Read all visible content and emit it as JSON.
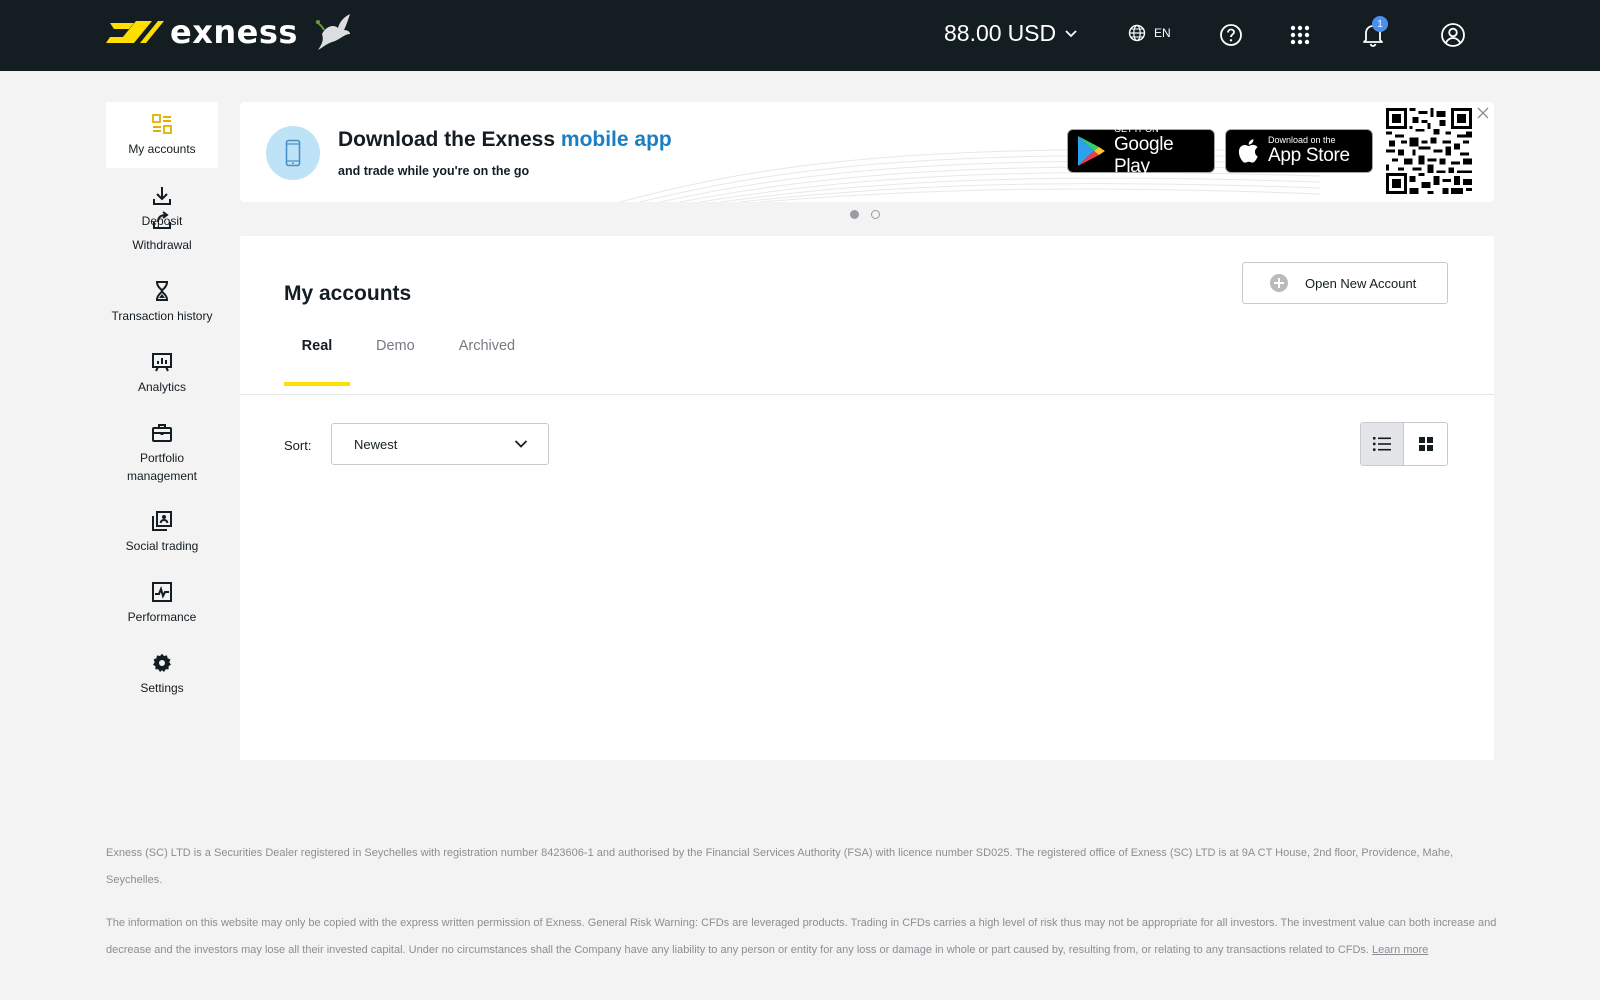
{
  "header": {
    "brand": "exness",
    "balance_amount": "88.00",
    "balance_currency": "USD",
    "language": "EN",
    "notification_count": "1"
  },
  "sidebar": {
    "items": [
      {
        "label": "My accounts",
        "icon": "my-accounts-icon",
        "active": true
      },
      {
        "label": "Deposit",
        "icon": "deposit-icon"
      },
      {
        "label": "Withdrawal",
        "icon": "withdrawal-icon"
      },
      {
        "label": "Transaction history",
        "icon": "hourglass-icon"
      },
      {
        "label": "Analytics",
        "icon": "analytics-icon"
      },
      {
        "label": "Portfolio management",
        "icon": "briefcase-icon"
      },
      {
        "label": "Social trading",
        "icon": "social-trading-icon"
      },
      {
        "label": "Performance",
        "icon": "performance-icon"
      },
      {
        "label": "Settings",
        "icon": "gear-icon"
      }
    ]
  },
  "banner": {
    "title_prefix": "Download the Exness ",
    "title_highlight": "mobile app",
    "subtitle": "and trade while you're on the go",
    "google_small": "GET IT ON",
    "google_big": "Google Play",
    "apple_small": "Download on the",
    "apple_big": "App Store"
  },
  "main": {
    "title": "My accounts",
    "open_button": "Open New Account",
    "tabs": [
      {
        "label": "Real",
        "active": true
      },
      {
        "label": "Demo"
      },
      {
        "label": "Archived"
      }
    ],
    "sort_label": "Sort:",
    "sort_value": "Newest"
  },
  "footer": {
    "legal_1": "Exness (SC) LTD is a Securities Dealer registered in Seychelles with registration number 8423606-1 and authorised by the Financial Services Authority (FSA) with licence number SD025. The registered office of Exness (SC) LTD is at 9A CT House, 2nd floor, Providence, Mahe, Seychelles.",
    "legal_2": "The information on this website may only be copied with the express written permission of Exness. General Risk Warning: CFDs are leveraged products. Trading in CFDs carries a high level of risk thus may not be appropriate for all investors. The investment value can both increase and decrease and the investors may lose all their invested capital. Under no circumstances shall the Company have any liability to any person or entity for any loss or damage in whole or part caused by, resulting from, or relating to any transactions related to CFDs.",
    "learn_more": "Learn more"
  },
  "colors": {
    "header_bg": "#141d22",
    "accent_yellow": "#ffde02",
    "link_blue": "#1b7ec2",
    "badge_blue": "#4b8ff0"
  }
}
